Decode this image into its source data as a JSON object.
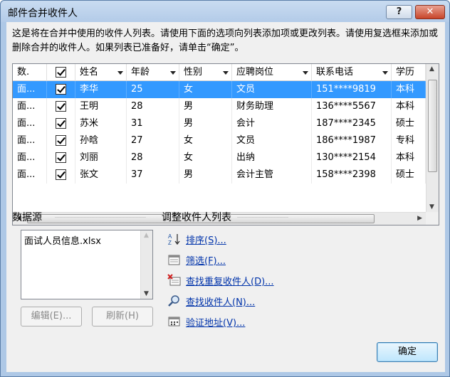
{
  "window": {
    "title": "邮件合并收件人",
    "help_label": "?",
    "close_label": "✕"
  },
  "description": "这是将在合并中使用的收件人列表。请使用下面的选项向列表添加项或更改列表。请使用复选框来添加或删除合并的收件人。如果列表已准备好，请单击“确定”。",
  "table": {
    "columns": [
      "数.",
      "",
      "姓名",
      "年龄",
      "性别",
      "应聘岗位",
      "联系电话",
      "学历"
    ],
    "rows": [
      {
        "source": "面...",
        "name": "李华",
        "age": "25",
        "gender": "女",
        "position": "文员",
        "phone": "151****9819",
        "edu": "本科",
        "selected": true
      },
      {
        "source": "面...",
        "name": "王明",
        "age": "28",
        "gender": "男",
        "position": "财务助理",
        "phone": "136****5567",
        "edu": "本科"
      },
      {
        "source": "面...",
        "name": "苏米",
        "age": "31",
        "gender": "男",
        "position": "会计",
        "phone": "187****2345",
        "edu": "硕士"
      },
      {
        "source": "面...",
        "name": "孙晗",
        "age": "27",
        "gender": "女",
        "position": "文员",
        "phone": "186****1987",
        "edu": "专科"
      },
      {
        "source": "面...",
        "name": "刘丽",
        "age": "28",
        "gender": "女",
        "position": "出纳",
        "phone": "130****2154",
        "edu": "本科"
      },
      {
        "source": "面...",
        "name": "张文",
        "age": "37",
        "gender": "男",
        "position": "会计主管",
        "phone": "158****2398",
        "edu": "硕士"
      }
    ]
  },
  "datasource": {
    "label": "数据源",
    "items": [
      "面试人员信息.xlsx"
    ],
    "edit_label": "编辑(E)...",
    "refresh_label": "刷新(H)"
  },
  "refine": {
    "label": "调整收件人列表",
    "links": [
      {
        "label": "排序(S)...",
        "icon": "sort-icon"
      },
      {
        "label": "筛选(F)...",
        "icon": "filter-icon"
      },
      {
        "label": "查找重复收件人(D)...",
        "icon": "find-duplicates-icon"
      },
      {
        "label": "查找收件人(N)...",
        "icon": "find-recipient-icon"
      },
      {
        "label": "验证地址(V)...",
        "icon": "validate-address-icon"
      }
    ]
  },
  "ok_label": "确定"
}
